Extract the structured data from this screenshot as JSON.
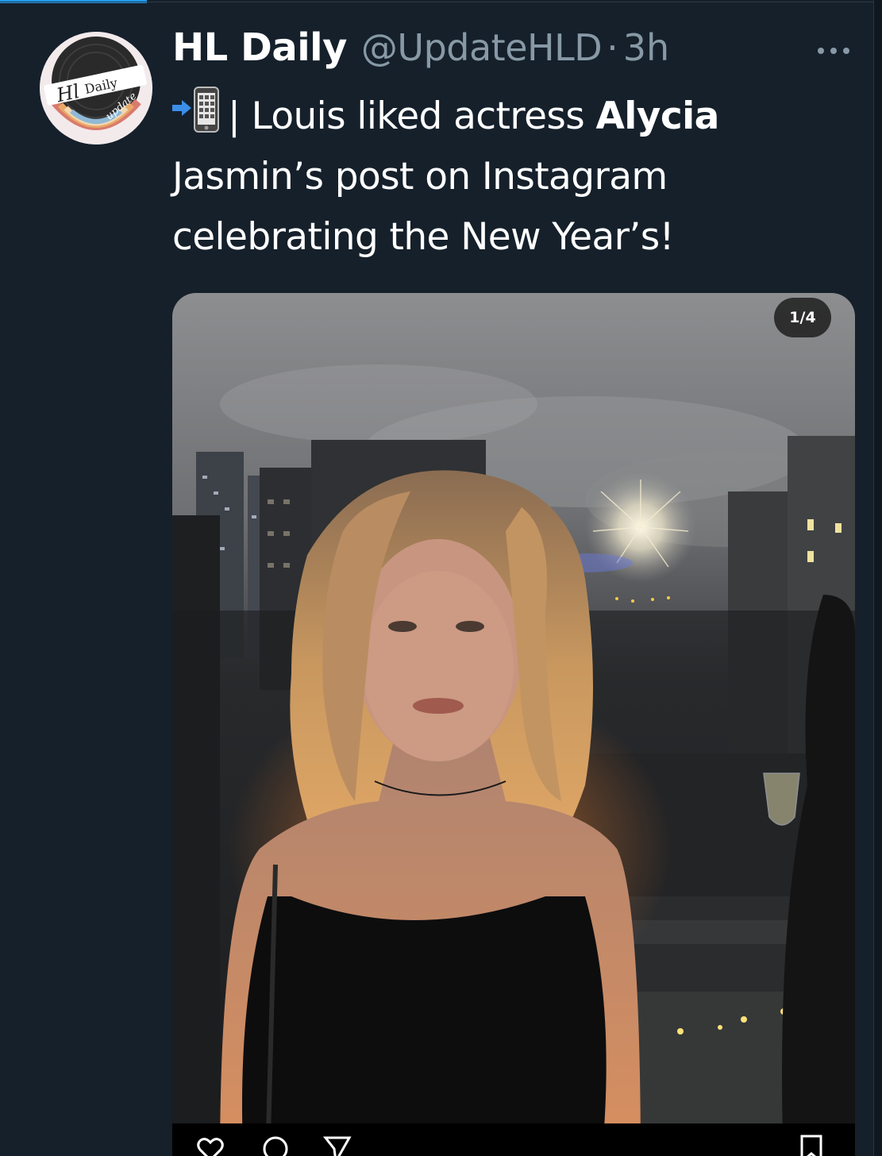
{
  "tweet": {
    "display_name": "HL Daily",
    "handle": "@UpdateHLD",
    "separator": "·",
    "time": "3h",
    "text_part1": "| Louis liked actress ",
    "text_bold": "Alycia",
    "text_part2": " Jasmin’s post on Instagram celebrating the New Year’s!",
    "emoji_icon": "mobile-phone-with-arrow-icon"
  },
  "avatar": {
    "logo_text": "HL Daily",
    "logo_subtext": "update"
  },
  "media": {
    "counter": "1/4"
  },
  "colors": {
    "background": "#15202b",
    "text": "#ffffff",
    "secondary": "#8899a6",
    "accent": "#1d9bf0"
  }
}
